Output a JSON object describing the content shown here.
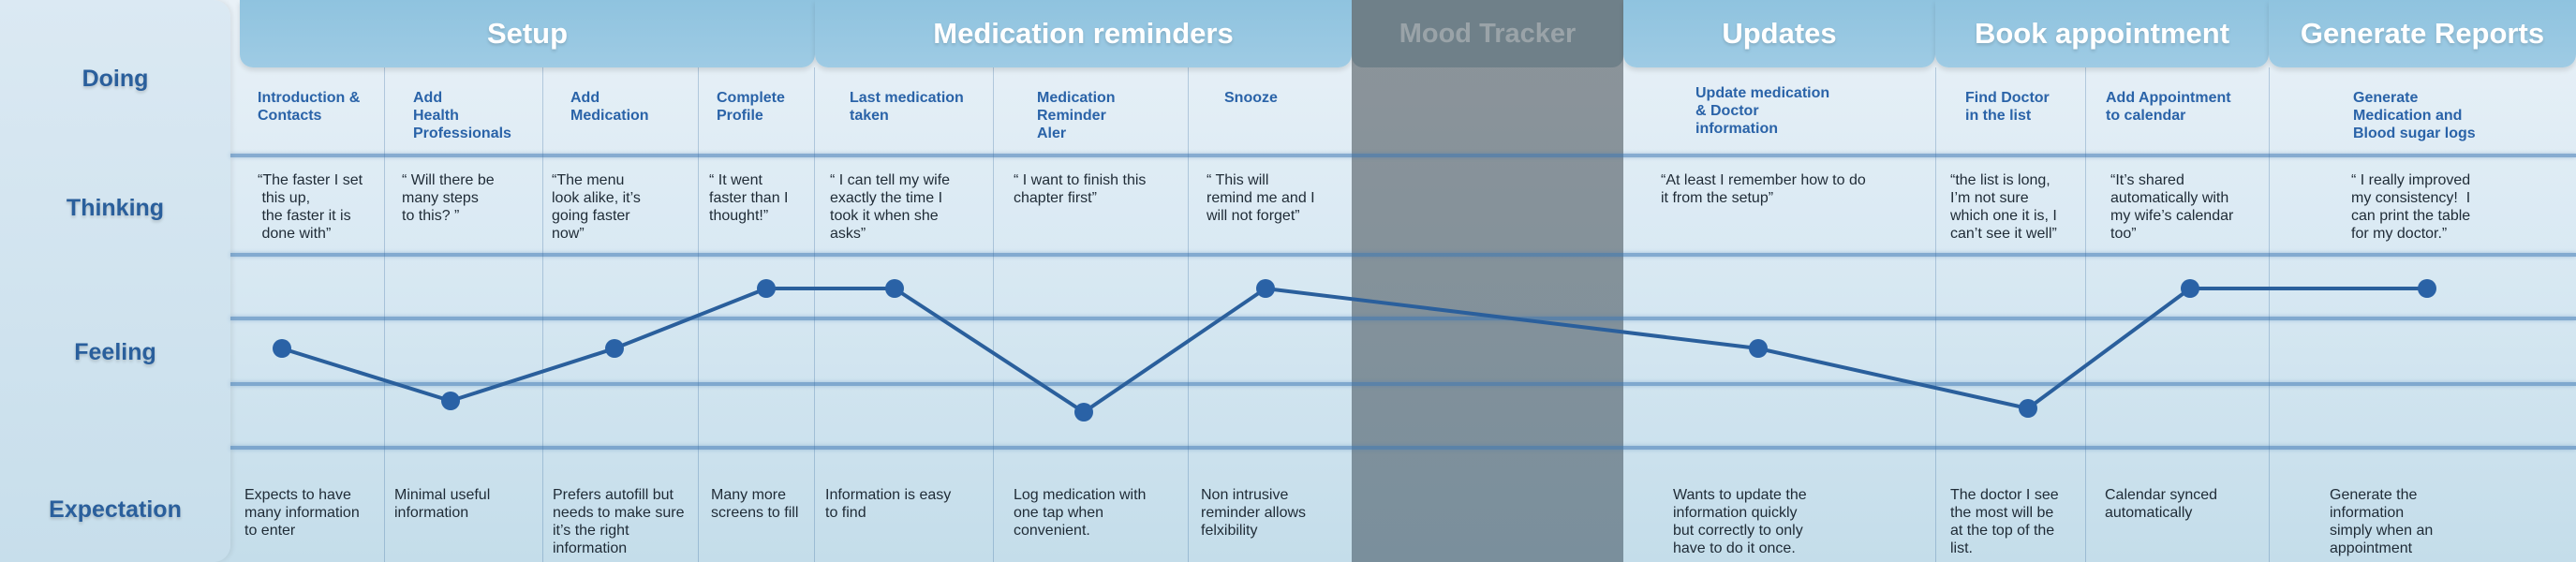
{
  "rows": {
    "doing": "Doing",
    "thinking": "Thinking",
    "feeling": "Feeling",
    "expectation": "Expectation"
  },
  "phases": [
    {
      "label": "Setup"
    },
    {
      "label": "Medication reminders"
    },
    {
      "label": "Mood Tracker"
    },
    {
      "label": "Updates"
    },
    {
      "label": "Book appointment"
    },
    {
      "label": "Generate Reports"
    }
  ],
  "steps": [
    {
      "doing": "Introduction &\nContacts",
      "thinking": "“The faster I set\n this up,\n the faster it is\n done with”",
      "expectation": "Expects to have\nmany information\nto enter"
    },
    {
      "doing": "Add\nHealth\nProfessionals",
      "thinking": "“ Will there be\nmany steps\nto this? ”",
      "expectation": "Minimal useful\ninformation"
    },
    {
      "doing": "Add\nMedication",
      "thinking": "“The menu\nlook alike, it’s\ngoing faster\nnow”",
      "expectation": "Prefers autofill but\nneeds to make sure\nit’s the right\ninformation"
    },
    {
      "doing": "Complete\nProfile",
      "thinking": "“ It went\nfaster than I\nthought!”",
      "expectation": "Many more\nscreens to fill"
    },
    {
      "doing": "Last medication\ntaken",
      "thinking": "“ I can tell my wife\nexactly the time I\ntook it when she\nasks”",
      "expectation": "Information is easy\nto find"
    },
    {
      "doing": "Medication\nReminder\nAler",
      "thinking": "“ I want to finish this\nchapter first”",
      "expectation": "Log medication with\none tap when\nconvenient."
    },
    {
      "doing": "Snooze",
      "thinking": "“ This will\nremind me and I\nwill not forget”",
      "expectation": "Non intrusive\nreminder allows\nfelxibility"
    },
    {
      "doing": "Update medication\n& Doctor\ninformation",
      "thinking": "“At least I remember how to do\nit from the setup”",
      "expectation": "Wants to update the\ninformation quickly\nbut correctly to only\nhave to do it once."
    },
    {
      "doing": "Find Doctor\nin the list",
      "thinking": "“the list is long,\nI’m not sure\nwhich one it is, I\ncan’t see it well”",
      "expectation": "The doctor I see\nthe most will be\nat the top of the\nlist."
    },
    {
      "doing": "Add Appointment\nto calendar",
      "thinking": "“It’s shared\nautomatically with\nmy wife’s calendar\ntoo”",
      "expectation": "Calendar synced\nautomatically"
    },
    {
      "doing": "Generate\nMedication and\nBlood sugar logs",
      "thinking": "“ I really improved\nmy consistency!  I\ncan print the table\nfor my doctor.”",
      "expectation": "Generate the\ninformation\nsimply when an\nappointment"
    }
  ],
  "feeling_scale": [
    3,
    1.6,
    3,
    4.6,
    4.6,
    1.3,
    4.6,
    3,
    1.4,
    4.6,
    4.6
  ],
  "colors": {
    "line": "#2a5f9c",
    "dot": "#2a62a6",
    "phase": "#9ecbe4",
    "mood": "#7a8f9c"
  }
}
